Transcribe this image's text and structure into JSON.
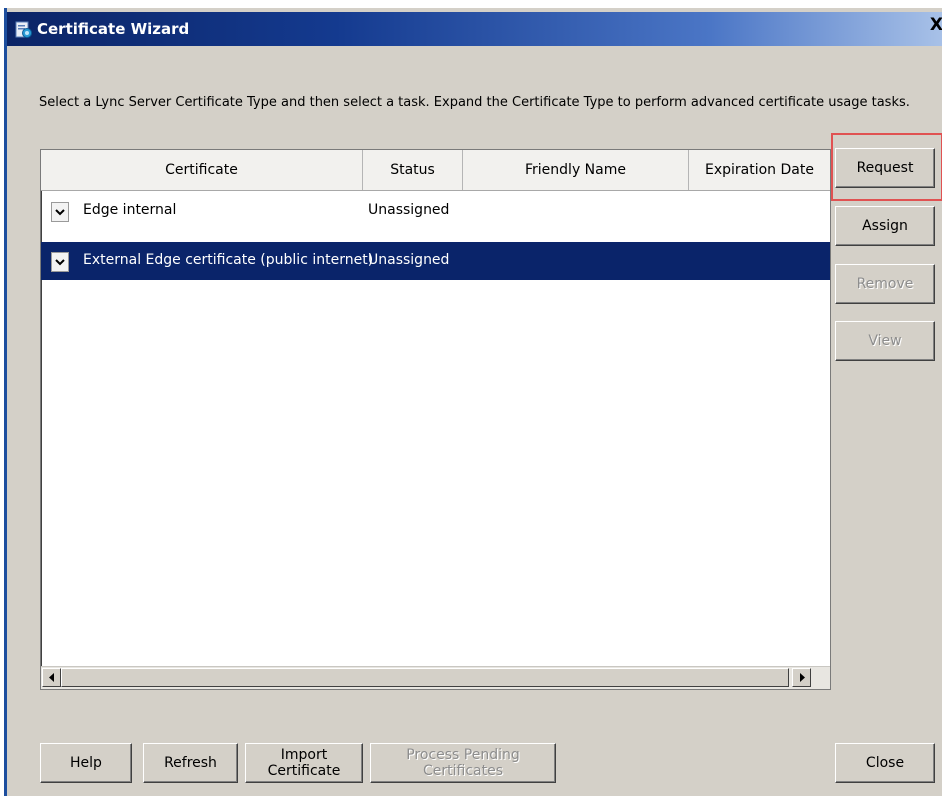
{
  "window": {
    "title": "Certificate Wizard",
    "close_label": "X"
  },
  "instructions": "Select a Lync Server Certificate Type and then select a task. Expand the Certificate Type to perform advanced certificate usage tasks.",
  "grid": {
    "columns": [
      "Certificate",
      "Status",
      "Friendly Name",
      "Expiration Date"
    ],
    "rows": [
      {
        "certificate": "Edge internal",
        "status": "Unassigned",
        "friendly_name": "",
        "expiration_date": "",
        "selected": false
      },
      {
        "certificate": "External Edge certificate (public internet)",
        "status": "Unassigned",
        "friendly_name": "",
        "expiration_date": "",
        "selected": true
      }
    ]
  },
  "side_buttons": {
    "request": "Request",
    "assign": "Assign",
    "remove": "Remove",
    "view": "View"
  },
  "bottom_buttons": {
    "help": "Help",
    "refresh": "Refresh",
    "import": "Import Certificate",
    "process_pending": "Process Pending Certificates",
    "close": "Close"
  },
  "colors": {
    "selection": "#0a246a",
    "highlight": "#e05252",
    "titlebar_start": "#0b2466",
    "titlebar_end": "#a9c2e8"
  },
  "icons": {
    "app": "certificate-icon",
    "expander": "chevron-down-icon",
    "scroll_left": "arrow-left-icon",
    "scroll_right": "arrow-right-icon"
  }
}
